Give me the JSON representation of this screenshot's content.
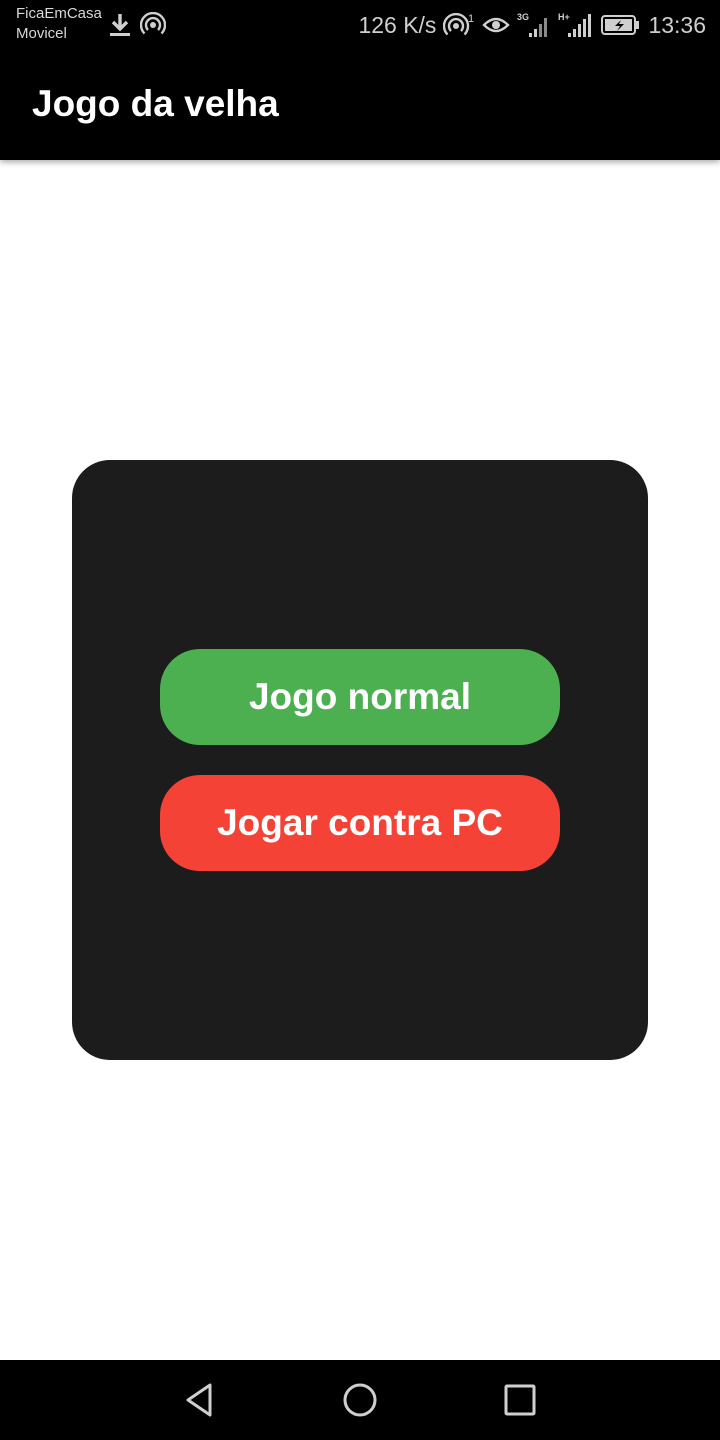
{
  "status_bar": {
    "carrier_line1": "FicaEmCasa",
    "carrier_line2": "Movicel",
    "net_speed": "126 K/s",
    "hotspot_count": "1",
    "network_3g": "3G",
    "network_h": "H+",
    "time": "13:36",
    "icons": [
      "download-icon",
      "hotspot-icon",
      "hotspot-icon",
      "eye-icon",
      "signal-icon",
      "signal-icon",
      "battery-charging-icon"
    ]
  },
  "app_bar": {
    "title": "Jogo da velha"
  },
  "menu": {
    "buttons": [
      {
        "label": "Jogo normal",
        "color": "#4caf50"
      },
      {
        "label": "Jogar contra PC",
        "color": "#f44336"
      }
    ],
    "card_color": "#1c1c1c"
  },
  "nav_bar": {
    "icons": [
      "back-icon",
      "home-icon",
      "recents-icon"
    ]
  }
}
